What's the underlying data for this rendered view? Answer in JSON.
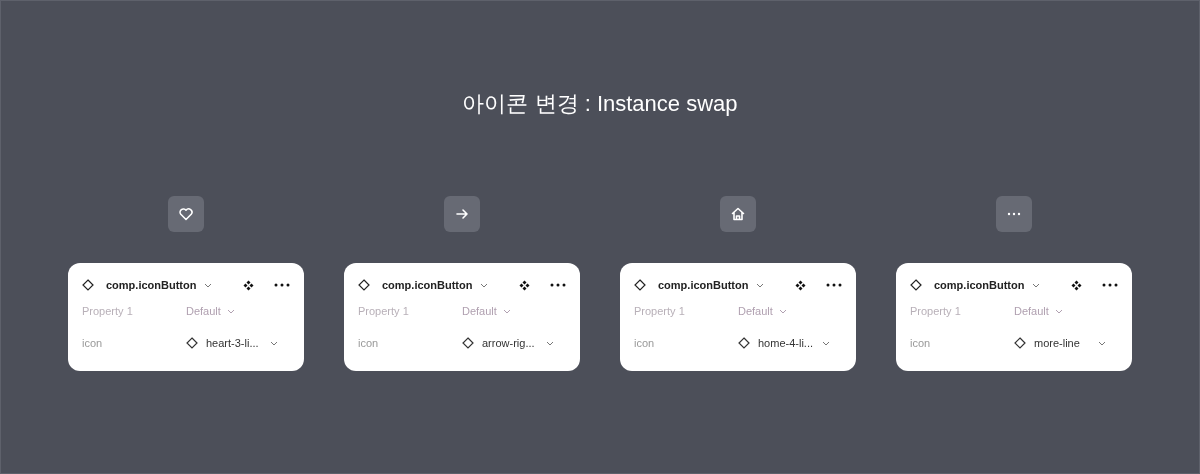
{
  "title": "아이콘 변경 : Instance swap",
  "columns": [
    {
      "icon_button": {
        "kind": "heart"
      },
      "panel": {
        "component": "comp.iconButton",
        "properties": [
          {
            "label": "Property 1",
            "value": "Default",
            "disabled": true,
            "kind": "variant"
          },
          {
            "label": "icon",
            "value": "heart-3-li...",
            "disabled": false,
            "kind": "instance"
          }
        ]
      }
    },
    {
      "icon_button": {
        "kind": "arrow"
      },
      "panel": {
        "component": "comp.iconButton",
        "properties": [
          {
            "label": "Property 1",
            "value": "Default",
            "disabled": true,
            "kind": "variant"
          },
          {
            "label": "icon",
            "value": "arrow-rig...",
            "disabled": false,
            "kind": "instance"
          }
        ]
      }
    },
    {
      "icon_button": {
        "kind": "home"
      },
      "panel": {
        "component": "comp.iconButton",
        "properties": [
          {
            "label": "Property 1",
            "value": "Default",
            "disabled": true,
            "kind": "variant"
          },
          {
            "label": "icon",
            "value": "home-4-li...",
            "disabled": false,
            "kind": "instance"
          }
        ]
      }
    },
    {
      "icon_button": {
        "kind": "more"
      },
      "panel": {
        "component": "comp.iconButton",
        "properties": [
          {
            "label": "Property 1",
            "value": "Default",
            "disabled": true,
            "kind": "variant"
          },
          {
            "label": "icon",
            "value": "more-line",
            "disabled": false,
            "kind": "instance"
          }
        ]
      }
    }
  ]
}
